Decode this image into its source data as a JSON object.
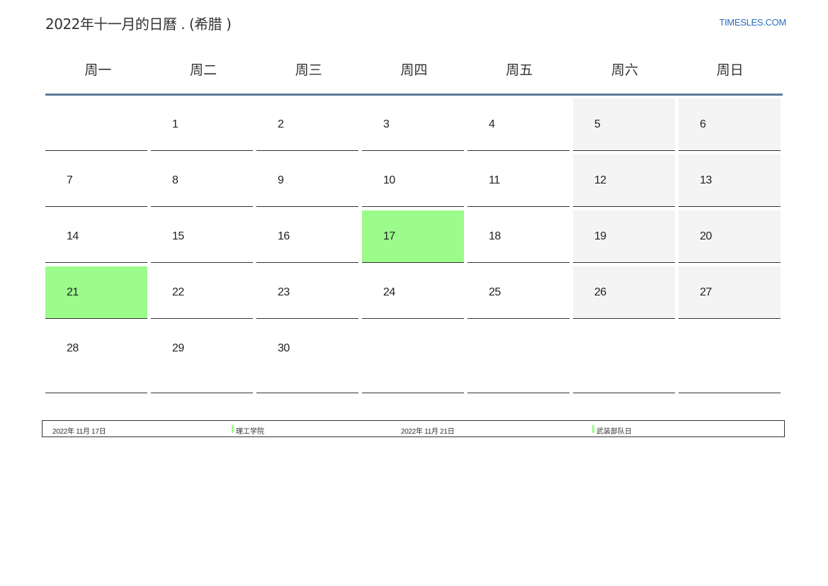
{
  "header": {
    "title": "2022年十一月的日曆 . (希腊 )",
    "site": "TIMESLES.COM"
  },
  "weekdays": [
    "周一",
    "周二",
    "周三",
    "周四",
    "周五",
    "周六",
    "周日"
  ],
  "weeks": [
    [
      "",
      "1",
      "2",
      "3",
      "4",
      "5",
      "6"
    ],
    [
      "7",
      "8",
      "9",
      "10",
      "11",
      "12",
      "13"
    ],
    [
      "14",
      "15",
      "16",
      "17",
      "18",
      "19",
      "20"
    ],
    [
      "21",
      "22",
      "23",
      "24",
      "25",
      "26",
      "27"
    ],
    [
      "28",
      "29",
      "30",
      "",
      "",
      "",
      ""
    ]
  ],
  "colors": {
    "holiday": "#9bfb8b",
    "weekend": "#f4f4f4",
    "header_rule": "#5b7a9a",
    "site_link": "#2a6ebb"
  },
  "holidays": [
    {
      "date": "2022年 11月 17日",
      "name": "理工学院"
    },
    {
      "date": "2022年 11月 21日",
      "name": "武装部队日"
    }
  ]
}
